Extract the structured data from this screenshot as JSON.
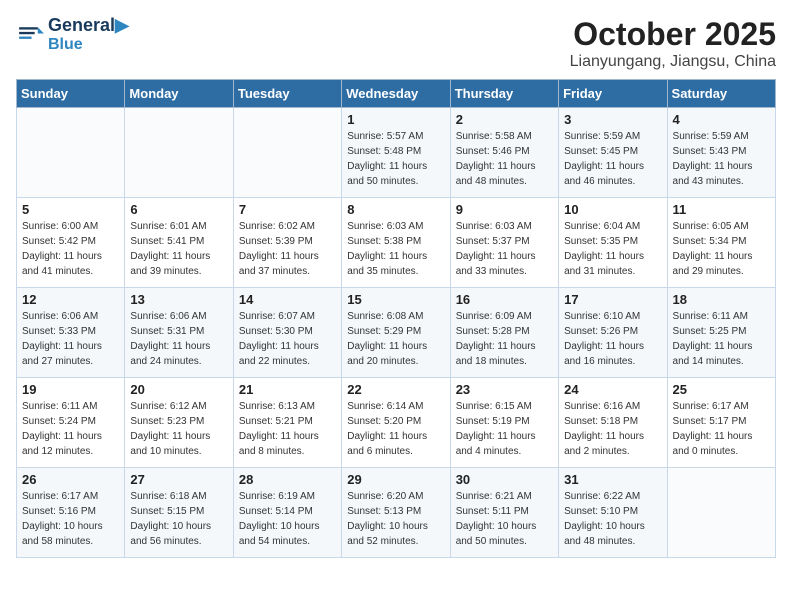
{
  "header": {
    "logo_line1": "General",
    "logo_line2": "Blue",
    "month": "October 2025",
    "location": "Lianyungang, Jiangsu, China"
  },
  "weekdays": [
    "Sunday",
    "Monday",
    "Tuesday",
    "Wednesday",
    "Thursday",
    "Friday",
    "Saturday"
  ],
  "weeks": [
    [
      {
        "day": "",
        "info": ""
      },
      {
        "day": "",
        "info": ""
      },
      {
        "day": "",
        "info": ""
      },
      {
        "day": "1",
        "info": "Sunrise: 5:57 AM\nSunset: 5:48 PM\nDaylight: 11 hours\nand 50 minutes."
      },
      {
        "day": "2",
        "info": "Sunrise: 5:58 AM\nSunset: 5:46 PM\nDaylight: 11 hours\nand 48 minutes."
      },
      {
        "day": "3",
        "info": "Sunrise: 5:59 AM\nSunset: 5:45 PM\nDaylight: 11 hours\nand 46 minutes."
      },
      {
        "day": "4",
        "info": "Sunrise: 5:59 AM\nSunset: 5:43 PM\nDaylight: 11 hours\nand 43 minutes."
      }
    ],
    [
      {
        "day": "5",
        "info": "Sunrise: 6:00 AM\nSunset: 5:42 PM\nDaylight: 11 hours\nand 41 minutes."
      },
      {
        "day": "6",
        "info": "Sunrise: 6:01 AM\nSunset: 5:41 PM\nDaylight: 11 hours\nand 39 minutes."
      },
      {
        "day": "7",
        "info": "Sunrise: 6:02 AM\nSunset: 5:39 PM\nDaylight: 11 hours\nand 37 minutes."
      },
      {
        "day": "8",
        "info": "Sunrise: 6:03 AM\nSunset: 5:38 PM\nDaylight: 11 hours\nand 35 minutes."
      },
      {
        "day": "9",
        "info": "Sunrise: 6:03 AM\nSunset: 5:37 PM\nDaylight: 11 hours\nand 33 minutes."
      },
      {
        "day": "10",
        "info": "Sunrise: 6:04 AM\nSunset: 5:35 PM\nDaylight: 11 hours\nand 31 minutes."
      },
      {
        "day": "11",
        "info": "Sunrise: 6:05 AM\nSunset: 5:34 PM\nDaylight: 11 hours\nand 29 minutes."
      }
    ],
    [
      {
        "day": "12",
        "info": "Sunrise: 6:06 AM\nSunset: 5:33 PM\nDaylight: 11 hours\nand 27 minutes."
      },
      {
        "day": "13",
        "info": "Sunrise: 6:06 AM\nSunset: 5:31 PM\nDaylight: 11 hours\nand 24 minutes."
      },
      {
        "day": "14",
        "info": "Sunrise: 6:07 AM\nSunset: 5:30 PM\nDaylight: 11 hours\nand 22 minutes."
      },
      {
        "day": "15",
        "info": "Sunrise: 6:08 AM\nSunset: 5:29 PM\nDaylight: 11 hours\nand 20 minutes."
      },
      {
        "day": "16",
        "info": "Sunrise: 6:09 AM\nSunset: 5:28 PM\nDaylight: 11 hours\nand 18 minutes."
      },
      {
        "day": "17",
        "info": "Sunrise: 6:10 AM\nSunset: 5:26 PM\nDaylight: 11 hours\nand 16 minutes."
      },
      {
        "day": "18",
        "info": "Sunrise: 6:11 AM\nSunset: 5:25 PM\nDaylight: 11 hours\nand 14 minutes."
      }
    ],
    [
      {
        "day": "19",
        "info": "Sunrise: 6:11 AM\nSunset: 5:24 PM\nDaylight: 11 hours\nand 12 minutes."
      },
      {
        "day": "20",
        "info": "Sunrise: 6:12 AM\nSunset: 5:23 PM\nDaylight: 11 hours\nand 10 minutes."
      },
      {
        "day": "21",
        "info": "Sunrise: 6:13 AM\nSunset: 5:21 PM\nDaylight: 11 hours\nand 8 minutes."
      },
      {
        "day": "22",
        "info": "Sunrise: 6:14 AM\nSunset: 5:20 PM\nDaylight: 11 hours\nand 6 minutes."
      },
      {
        "day": "23",
        "info": "Sunrise: 6:15 AM\nSunset: 5:19 PM\nDaylight: 11 hours\nand 4 minutes."
      },
      {
        "day": "24",
        "info": "Sunrise: 6:16 AM\nSunset: 5:18 PM\nDaylight: 11 hours\nand 2 minutes."
      },
      {
        "day": "25",
        "info": "Sunrise: 6:17 AM\nSunset: 5:17 PM\nDaylight: 11 hours\nand 0 minutes."
      }
    ],
    [
      {
        "day": "26",
        "info": "Sunrise: 6:17 AM\nSunset: 5:16 PM\nDaylight: 10 hours\nand 58 minutes."
      },
      {
        "day": "27",
        "info": "Sunrise: 6:18 AM\nSunset: 5:15 PM\nDaylight: 10 hours\nand 56 minutes."
      },
      {
        "day": "28",
        "info": "Sunrise: 6:19 AM\nSunset: 5:14 PM\nDaylight: 10 hours\nand 54 minutes."
      },
      {
        "day": "29",
        "info": "Sunrise: 6:20 AM\nSunset: 5:13 PM\nDaylight: 10 hours\nand 52 minutes."
      },
      {
        "day": "30",
        "info": "Sunrise: 6:21 AM\nSunset: 5:11 PM\nDaylight: 10 hours\nand 50 minutes."
      },
      {
        "day": "31",
        "info": "Sunrise: 6:22 AM\nSunset: 5:10 PM\nDaylight: 10 hours\nand 48 minutes."
      },
      {
        "day": "",
        "info": ""
      }
    ]
  ]
}
